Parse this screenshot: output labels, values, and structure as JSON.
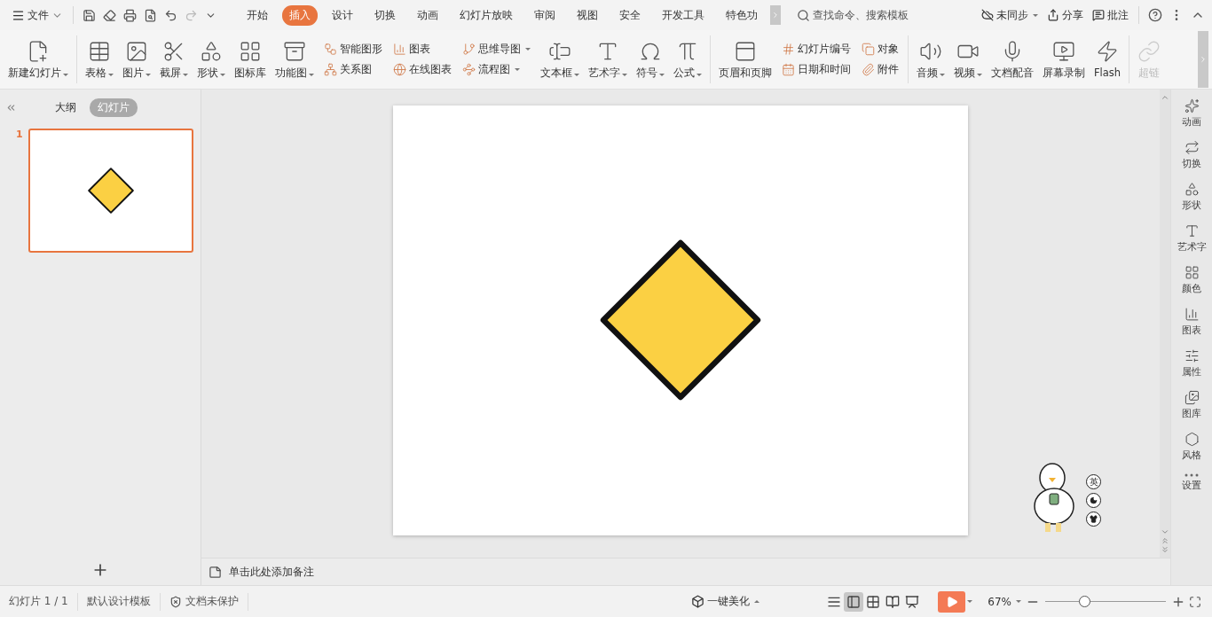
{
  "menu": {
    "file_label": "文件"
  },
  "tabs": [
    {
      "label": "开始",
      "selected": false
    },
    {
      "label": "插入",
      "selected": true
    },
    {
      "label": "设计",
      "selected": false
    },
    {
      "label": "切换",
      "selected": false
    },
    {
      "label": "动画",
      "selected": false
    },
    {
      "label": "幻灯片放映",
      "selected": false
    },
    {
      "label": "审阅",
      "selected": false
    },
    {
      "label": "视图",
      "selected": false
    },
    {
      "label": "安全",
      "selected": false
    },
    {
      "label": "开发工具",
      "selected": false
    },
    {
      "label": "特色功",
      "selected": false
    }
  ],
  "search": {
    "placeholder": "查找命令、搜索模板"
  },
  "top_actions": [
    {
      "label": "未同步",
      "dropdown": true
    },
    {
      "label": "分享",
      "dropdown": false
    },
    {
      "label": "批注",
      "dropdown": false
    }
  ],
  "ribbon": [
    {
      "kind": "large",
      "label": "新建幻灯片",
      "dropdown": true
    },
    {
      "kind": "separator"
    },
    {
      "kind": "large",
      "label": "表格",
      "dropdown": true
    },
    {
      "kind": "large",
      "label": "图片",
      "dropdown": true
    },
    {
      "kind": "large",
      "label": "截屏",
      "dropdown": true
    },
    {
      "kind": "large",
      "label": "形状",
      "dropdown": true
    },
    {
      "kind": "large",
      "label": "图标库",
      "dropdown": false
    },
    {
      "kind": "large",
      "label": "功能图",
      "dropdown": true
    },
    {
      "kind": "stack",
      "items": [
        {
          "label": "智能图形",
          "dropdown": false
        },
        {
          "label": "关系图",
          "dropdown": false
        }
      ]
    },
    {
      "kind": "stack",
      "items": [
        {
          "label": "图表",
          "dropdown": false
        },
        {
          "label": "在线图表",
          "dropdown": false
        }
      ]
    },
    {
      "kind": "stack",
      "items": [
        {
          "label": "思维导图",
          "dropdown": true
        },
        {
          "label": "流程图",
          "dropdown": true
        }
      ]
    },
    {
      "kind": "large",
      "label": "文本框",
      "dropdown": true
    },
    {
      "kind": "large",
      "label": "艺术字",
      "dropdown": true
    },
    {
      "kind": "large",
      "label": "符号",
      "dropdown": true
    },
    {
      "kind": "large",
      "label": "公式",
      "dropdown": true
    },
    {
      "kind": "separator"
    },
    {
      "kind": "large",
      "label": "页眉和页脚",
      "dropdown": false
    },
    {
      "kind": "stack",
      "items": [
        {
          "label": "幻灯片编号",
          "dropdown": false
        },
        {
          "label": "日期和时间",
          "dropdown": false
        }
      ]
    },
    {
      "kind": "stack",
      "items": [
        {
          "label": "对象",
          "dropdown": false
        },
        {
          "label": "附件",
          "dropdown": false
        }
      ]
    },
    {
      "kind": "separator"
    },
    {
      "kind": "large",
      "label": "音频",
      "dropdown": true
    },
    {
      "kind": "large",
      "label": "视频",
      "dropdown": true
    },
    {
      "kind": "large",
      "label": "文档配音",
      "dropdown": false
    },
    {
      "kind": "large",
      "label": "屏幕录制",
      "dropdown": false
    },
    {
      "kind": "large",
      "label": "Flash",
      "dropdown": false
    },
    {
      "kind": "separator"
    },
    {
      "kind": "large",
      "label": "超链",
      "dropdown": false,
      "disabled": true
    }
  ],
  "left_panel": {
    "tabs": [
      {
        "label": "大纲",
        "selected": false
      },
      {
        "label": "幻灯片",
        "selected": true
      }
    ],
    "slides": [
      {
        "number": "1",
        "selected": true
      }
    ]
  },
  "notes": {
    "placeholder": "单击此处添加备注"
  },
  "ime": {
    "lang": "英"
  },
  "right_sidebar": [
    {
      "label": "动画"
    },
    {
      "label": "切换"
    },
    {
      "label": "形状"
    },
    {
      "label": "艺术字"
    },
    {
      "label": "颜色"
    },
    {
      "label": "图表"
    },
    {
      "label": "属性"
    },
    {
      "label": "图库"
    },
    {
      "label": "风格"
    },
    {
      "label": "设置"
    }
  ],
  "status_bar": {
    "slide_info": "幻灯片 1 / 1",
    "template": "默认设计模板",
    "protection": "文档未保护",
    "beautify": "一键美化",
    "views": [
      {
        "selected": false
      },
      {
        "selected": true
      },
      {
        "selected": false
      },
      {
        "selected": false
      },
      {
        "selected": false
      }
    ],
    "zoom": "67%",
    "zoom_slider": {
      "level": 0.32
    }
  }
}
